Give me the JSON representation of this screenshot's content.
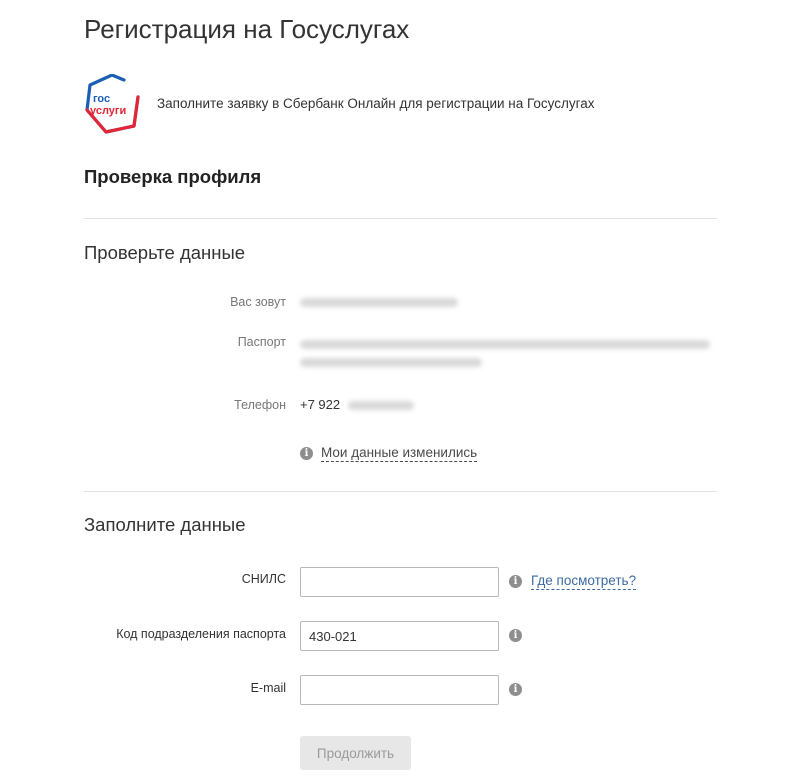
{
  "header": {
    "title": "Регистрация на Госуслугах"
  },
  "banner": {
    "logo_text_top": "гос",
    "logo_text_bottom": "услуги",
    "text": "Заполните заявку в Сбербанк Онлайн для регистрации на Госуслугах"
  },
  "profile": {
    "title": "Проверка профиля"
  },
  "check": {
    "title": "Проверьте данные",
    "name_label": "Вас зовут",
    "passport_label": "Паспорт",
    "phone_label": "Телефон",
    "phone_visible": "+7 922",
    "changed_link": "Мои данные изменились"
  },
  "fill": {
    "title": "Заполните данные",
    "snils_label": "СНИЛС",
    "snils_value": "",
    "where_link": "Где посмотреть?",
    "code_label": "Код подразделения паспорта",
    "code_value": "430-021",
    "email_label": "E-mail",
    "email_value": ""
  },
  "actions": {
    "continue_label": "Продолжить"
  },
  "colors": {
    "logo_blue": "#1a5fb4",
    "logo_red": "#e32636",
    "link_blue": "#3d6aa3",
    "icon_gray": "#8e8e8e"
  },
  "icons": {
    "info": "info-icon",
    "logo": "gosuslugi-logo"
  }
}
